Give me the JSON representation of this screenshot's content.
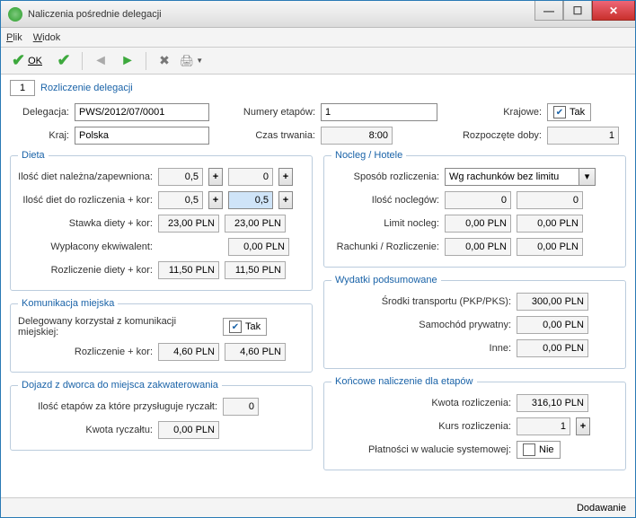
{
  "window": {
    "title": "Naliczenia pośrednie delegacji"
  },
  "menu": {
    "file": "Plik",
    "view": "Widok"
  },
  "toolbar": {
    "ok": "OK"
  },
  "top": {
    "index": "1",
    "title": "Rozliczenie delegacji",
    "delegacja_lbl": "Delegacja:",
    "delegacja": "PWS/2012/07/0001",
    "numery_lbl": "Numery etapów:",
    "numery": "1",
    "krajowe_lbl": "Krajowe:",
    "krajowe_txt": "Tak",
    "kraj_lbl": "Kraj:",
    "kraj": "Polska",
    "czas_lbl": "Czas trwania:",
    "czas": "8:00",
    "doby_lbl": "Rozpoczęte doby:",
    "doby": "1"
  },
  "dieta": {
    "legend": "Dieta",
    "nalezna_lbl": "Ilość diet należna/zapewniona:",
    "nalezna_a": "0,5",
    "nalezna_b": "0",
    "rozlicz_lbl": "Ilość diet do rozliczenia + kor:",
    "rozlicz_a": "0,5",
    "rozlicz_b": "0,5",
    "stawka_lbl": "Stawka diety + kor:",
    "stawka_a": "23,00 PLN",
    "stawka_b": "23,00 PLN",
    "ekw_lbl": "Wypłacony ekwiwalent:",
    "ekw": "0,00 PLN",
    "rd_lbl": "Rozliczenie diety + kor:",
    "rd_a": "11,50 PLN",
    "rd_b": "11,50 PLN"
  },
  "nocleg": {
    "legend": "Nocleg / Hotele",
    "sposob_lbl": "Sposób rozliczenia:",
    "sposob": "Wg rachunków bez limitu",
    "ilosc_lbl": "Ilość noclegów:",
    "ilosc_a": "0",
    "ilosc_b": "0",
    "limit_lbl": "Limit nocleg:",
    "limit_a": "0,00 PLN",
    "limit_b": "0,00 PLN",
    "rach_lbl": "Rachunki / Rozliczenie:",
    "rach_a": "0,00 PLN",
    "rach_b": "0,00 PLN"
  },
  "km": {
    "legend": "Komunikacja miejska",
    "deleg_lbl": "Delegowany korzystał z komunikacji miejskiej:",
    "deleg_txt": "Tak",
    "rk_lbl": "Rozliczenie + kor:",
    "rk_a": "4,60 PLN",
    "rk_b": "4,60 PLN"
  },
  "wyd": {
    "legend": "Wydatki podsumowane",
    "srodki_lbl": "Środki transportu (PKP/PKS):",
    "srodki": "300,00 PLN",
    "sam_lbl": "Samochód prywatny:",
    "sam": "0,00 PLN",
    "inne_lbl": "Inne:",
    "inne": "0,00 PLN"
  },
  "dojazd": {
    "legend": "Dojazd z dworca do miejsca zakwaterowania",
    "etapy_lbl": "Ilość etapów za które przysługuje ryczałt:",
    "etapy": "0",
    "kwota_lbl": "Kwota ryczałtu:",
    "kwota": "0,00 PLN"
  },
  "konc": {
    "legend": "Końcowe naliczenie dla etapów",
    "kw_lbl": "Kwota rozliczenia:",
    "kw": "316,10 PLN",
    "kurs_lbl": "Kurs rozliczenia:",
    "kurs": "1",
    "plat_lbl": "Płatności w walucie systemowej:",
    "plat_txt": "Nie"
  },
  "status": {
    "mode": "Dodawanie"
  }
}
